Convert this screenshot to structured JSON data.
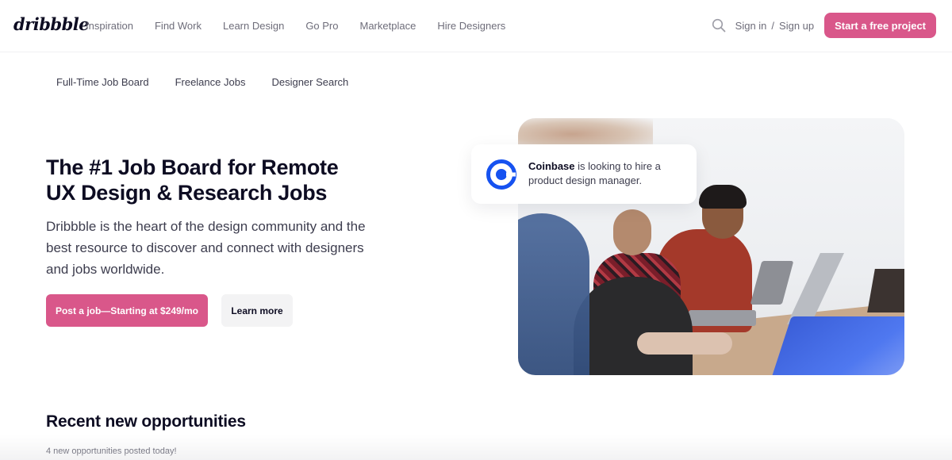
{
  "header": {
    "logo": "dribbble",
    "nav": [
      {
        "label": "Inspiration"
      },
      {
        "label": "Find Work"
      },
      {
        "label": "Learn Design"
      },
      {
        "label": "Go Pro"
      },
      {
        "label": "Marketplace"
      },
      {
        "label": "Hire Designers"
      }
    ],
    "search_icon": "search-icon",
    "sign_in": "Sign in",
    "separator": "/",
    "sign_up": "Sign up",
    "cta_label": "Start a free project"
  },
  "subnav": [
    {
      "label": "Full-Time Job Board"
    },
    {
      "label": "Freelance Jobs"
    },
    {
      "label": "Designer Search"
    }
  ],
  "hero": {
    "title_line1": "The #1 Job Board for Remote",
    "title_line2": "UX Design & Research Jobs",
    "description": "Dribbble is the heart of the design community and the best resource to discover and connect with designers and jobs worldwide.",
    "primary_button": "Post a job—Starting at $249/mo",
    "secondary_button": "Learn more",
    "photo_alt": "Designers working on laptops at a shared table"
  },
  "callout": {
    "company": "Coinbase",
    "text": " is looking to hire a product design manager.",
    "logo_icon": "coinbase-logo-icon",
    "logo_color": "#1652f0"
  },
  "recent": {
    "title": "Recent new opportunities",
    "subtitle": "4 new opportunities posted today!"
  },
  "colors": {
    "brand_pink": "#d9578a",
    "text_dark": "#0d0c22",
    "text_muted": "#6e6d7a"
  }
}
